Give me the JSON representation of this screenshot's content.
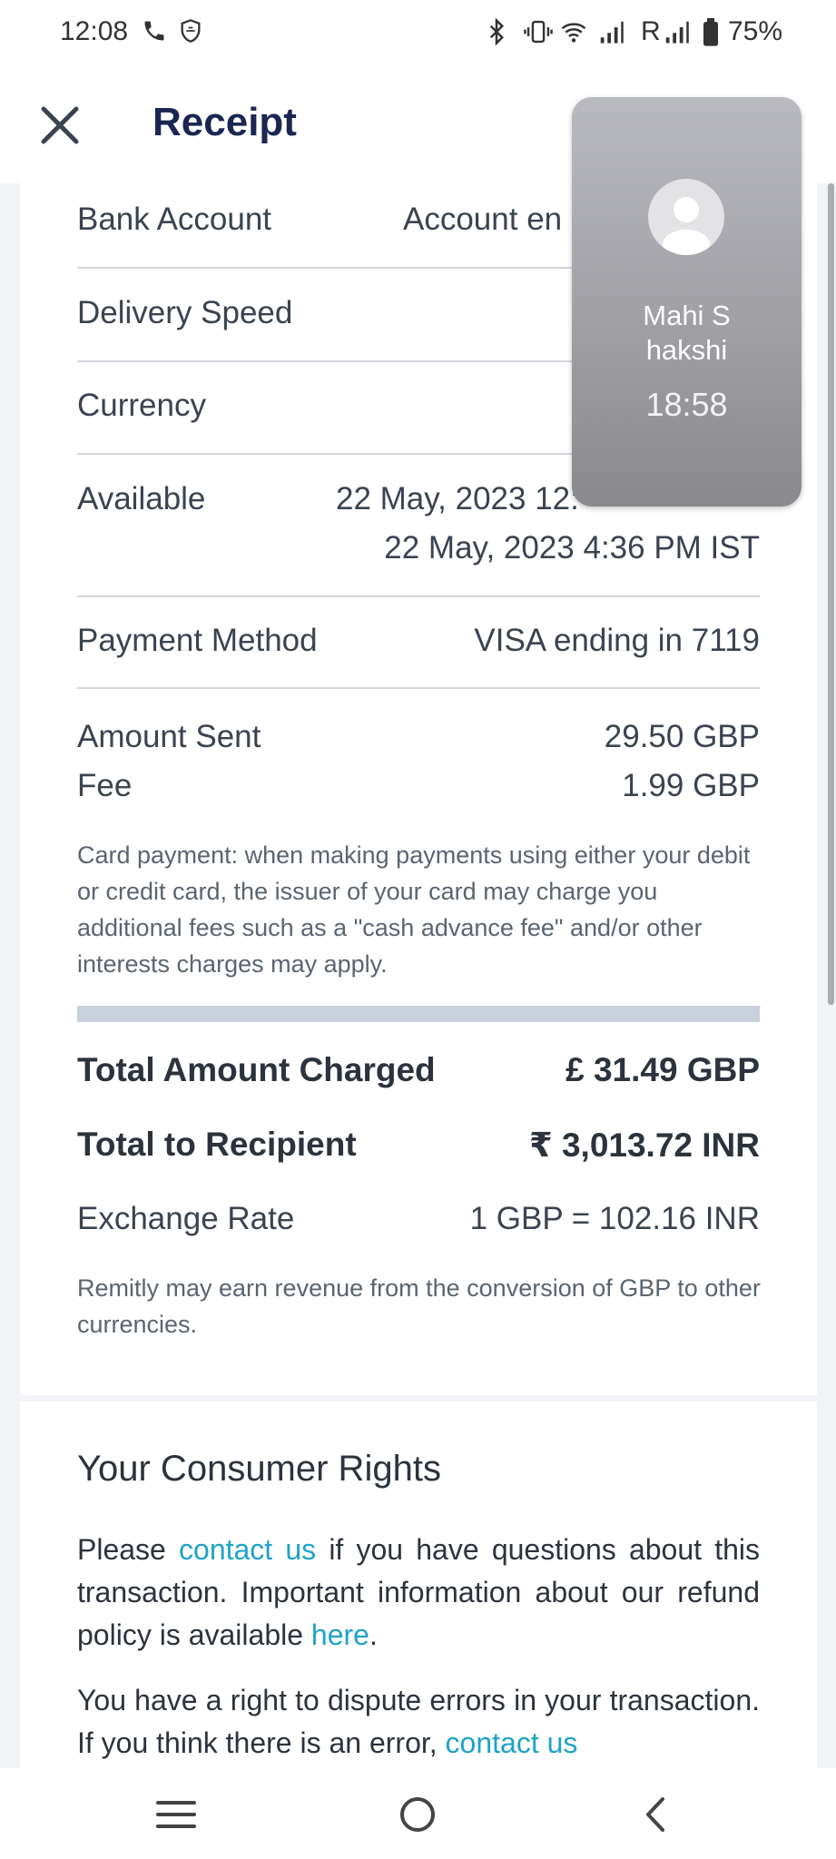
{
  "status_bar": {
    "time": "12:08",
    "network_label": "R",
    "battery": "75%",
    "icons": [
      "phone-call-icon",
      "shield-icon",
      "bluetooth-icon",
      "vibrate-icon",
      "wifi-icon",
      "signal-icon",
      "signal-icon-2",
      "battery-icon"
    ]
  },
  "header": {
    "title": "Receipt",
    "close_icon": "close-icon"
  },
  "details": {
    "bank_account": {
      "label": "Bank Account",
      "value": "Account en"
    },
    "delivery_speed": {
      "label": "Delivery Speed",
      "value": ""
    },
    "currency": {
      "label": "Currency",
      "value": ""
    },
    "available": {
      "label": "Available",
      "value_line1": "22 May, 2023 12:",
      "value_line2": "22 May, 2023 4:36 PM IST"
    },
    "payment_method": {
      "label": "Payment Method",
      "value": "VISA ending in 7119"
    },
    "amount_sent": {
      "label": "Amount Sent",
      "value": "29.50 GBP"
    },
    "fee": {
      "label": "Fee",
      "value": "1.99 GBP"
    },
    "card_note": "Card payment: when making payments using either your debit or credit card, the issuer of your card may charge you additional fees such as a \"cash advance fee\" and/or other interests charges may apply.",
    "total_charged": {
      "label": "Total Amount Charged",
      "value": "£ 31.49 GBP"
    },
    "total_recipient": {
      "label": "Total to Recipient",
      "value": "₹ 3,013.72 INR"
    },
    "exchange_rate": {
      "label": "Exchange Rate",
      "value": "1 GBP = 102.16 INR"
    },
    "revenue_note": "Remitly may earn revenue from the conversion of GBP to other currencies."
  },
  "consumer_rights": {
    "title": "Your Consumer Rights",
    "para1_a": "Please ",
    "para1_link1": "contact us",
    "para1_b": " if you have questions about this transaction. Important information about our refund policy is available ",
    "para1_link2": "here",
    "para1_c": ".",
    "para2_a": "You have a right to dispute errors in your transaction. If you think there is an error, ",
    "para2_link": "contact us"
  },
  "call_overlay": {
    "name": "Mahi S hakshi",
    "name_line1": "Mahi S",
    "name_line2": "hakshi",
    "duration": "18:58"
  },
  "nav": {
    "icons": [
      "recent-apps-icon",
      "home-icon",
      "back-icon"
    ]
  },
  "colors": {
    "title": "#1b2653",
    "link": "#1fa3c8",
    "text": "#3b4350",
    "divider": "#d3d8de",
    "thick_bar": "#c7d0db"
  }
}
